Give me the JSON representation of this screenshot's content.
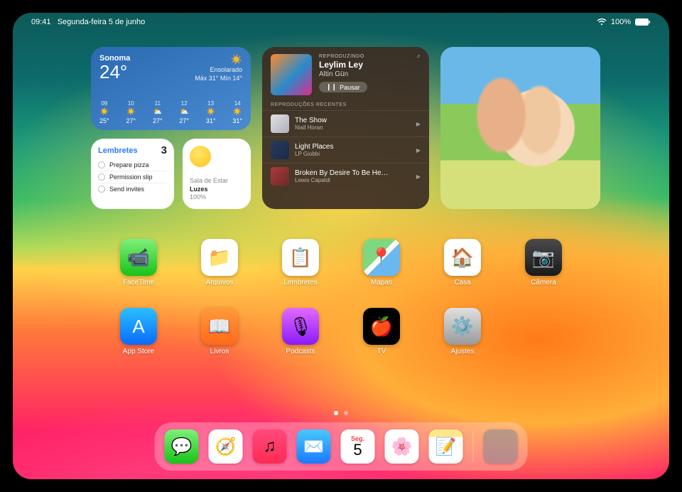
{
  "status": {
    "time": "09:41",
    "date": "Segunda-feira 5 de junho",
    "battery_pct": "100%"
  },
  "weather": {
    "location": "Sonoma",
    "temp": "24°",
    "condition": "Ensolarado",
    "hi_lo": "Máx 31° Mín 14°",
    "forecast": [
      {
        "hour": "09",
        "icon": "☀️",
        "temp": "25°"
      },
      {
        "hour": "10",
        "icon": "☀️",
        "temp": "27°"
      },
      {
        "hour": "11",
        "icon": "⛅",
        "temp": "27°"
      },
      {
        "hour": "12",
        "icon": "⛅",
        "temp": "27°"
      },
      {
        "hour": "13",
        "icon": "☀️",
        "temp": "31°"
      },
      {
        "hour": "14",
        "icon": "☀️",
        "temp": "31°"
      }
    ]
  },
  "reminders": {
    "title": "Lembretes",
    "count": "3",
    "items": [
      "Prepare pizza",
      "Permission slip",
      "Send invites"
    ]
  },
  "home": {
    "room": "Sala de Estar",
    "device": "Luzes",
    "level": "100%"
  },
  "music": {
    "now_label": "REPRODUZINDO",
    "title": "Leylim Ley",
    "artist": "Altin Gün",
    "pause_label": "Pausar",
    "recent_label": "REPRODUÇÕES RECENTES",
    "recent": [
      {
        "title": "The Show",
        "artist": "Niall Horan"
      },
      {
        "title": "Light Places",
        "artist": "LP Giobbi"
      },
      {
        "title": "Broken By Desire To Be He…",
        "artist": "Lewis Capaldi"
      }
    ]
  },
  "apps": {
    "row1": [
      {
        "name": "FaceTime",
        "cls": "i-facetime",
        "glyph": "📹"
      },
      {
        "name": "Arquivos",
        "cls": "i-files",
        "glyph": "📁"
      },
      {
        "name": "Lembretes",
        "cls": "i-reminders",
        "glyph": "📋"
      },
      {
        "name": "Mapas",
        "cls": "i-maps",
        "glyph": "📍"
      },
      {
        "name": "Casa",
        "cls": "i-home",
        "glyph": "🏠"
      },
      {
        "name": "Câmera",
        "cls": "i-camera",
        "glyph": "📷"
      }
    ],
    "row2": [
      {
        "name": "App Store",
        "cls": "i-appstore",
        "glyph": "A"
      },
      {
        "name": "Livros",
        "cls": "i-books",
        "glyph": "📖"
      },
      {
        "name": "Podcasts",
        "cls": "i-podcasts",
        "glyph": "🎙"
      },
      {
        "name": "TV",
        "cls": "i-tv",
        "glyph": "🍎"
      },
      {
        "name": "Ajustes",
        "cls": "i-settings",
        "glyph": "⚙️"
      }
    ]
  },
  "dock": [
    {
      "name": "Mensagens",
      "cls": "i-messages",
      "glyph": "💬"
    },
    {
      "name": "Safari",
      "cls": "i-safari",
      "glyph": "🧭"
    },
    {
      "name": "Música",
      "cls": "i-music",
      "glyph": "♫"
    },
    {
      "name": "Mail",
      "cls": "i-mail",
      "glyph": "✉️"
    },
    {
      "name": "Calendário",
      "cls": "i-cal",
      "day": "Seg.",
      "num": "5"
    },
    {
      "name": "Fotos",
      "cls": "i-photos",
      "glyph": "🌸"
    },
    {
      "name": "Notas",
      "cls": "i-notes",
      "glyph": "📝"
    }
  ]
}
